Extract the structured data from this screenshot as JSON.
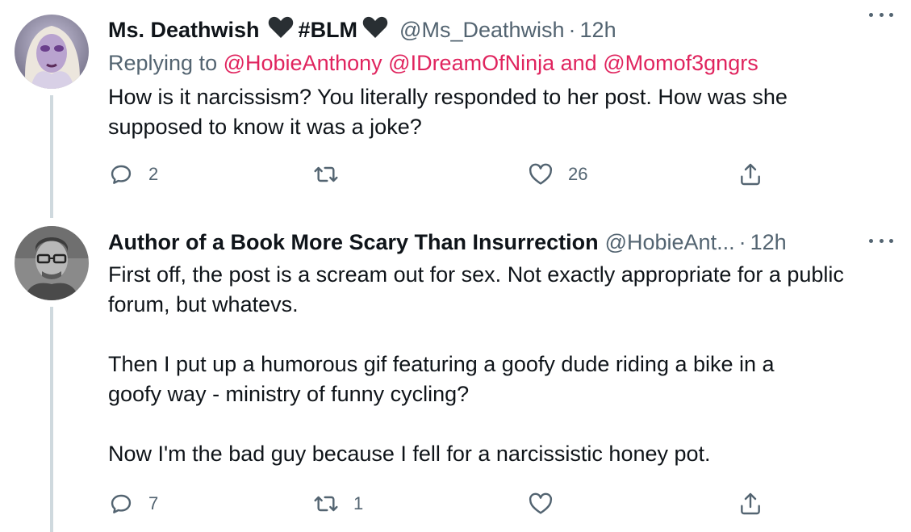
{
  "tweets": [
    {
      "display_name": "Ms. Deathwish",
      "badge_text": "#BLM",
      "handle": "@Ms_Deathwish",
      "separator": "·",
      "time": "12h",
      "replying_prefix": "Replying to",
      "mention_1": "@HobieAnthony",
      "mention_2": "@IDreamOfNinja",
      "and_word": "and",
      "mention_3": "@Momof3gngrs",
      "text": "How is it narcissism? You literally responded to her post. How was she\nsupposed to know it was a joke?",
      "reply_count": "2",
      "retweet_count": "",
      "like_count": "26"
    },
    {
      "display_name": "Author of a Book More Scary Than Insurrection",
      "handle": "@HobieAnt...",
      "separator": "·",
      "time": "12h",
      "text": "First off, the post is a scream out for sex. Not exactly appropriate for a public\nforum, but whatevs.\n\nThen I put up a humorous gif featuring a goofy dude riding a bike in a\ngoofy way - ministry of funny cycling?\n\nNow I'm the bad guy because I fell for a narcissistic honey pot.",
      "reply_count": "7",
      "retweet_count": "1",
      "like_count": ""
    }
  ],
  "colors": {
    "mention": "#e0245e",
    "secondary_text": "#536471",
    "primary_text": "#0f1419",
    "thread_line": "#cfd9de"
  },
  "icons": [
    "heart-icon",
    "more-icon",
    "reply-icon",
    "retweet-icon",
    "like-icon",
    "share-icon"
  ]
}
